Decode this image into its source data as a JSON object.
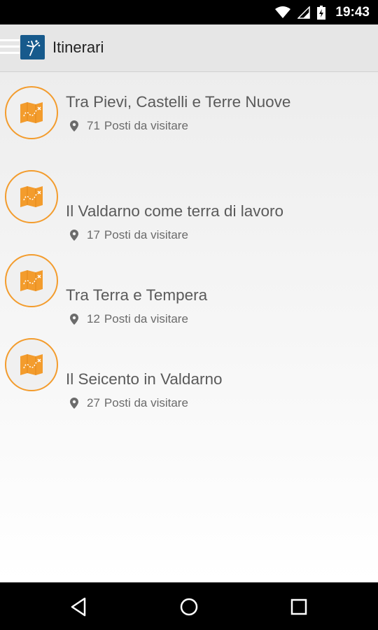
{
  "status_bar": {
    "time": "19:43"
  },
  "app_bar": {
    "title": "Itinerari"
  },
  "itineraries": [
    {
      "title": "Tra Pievi, Castelli e Terre Nuove",
      "count": "71",
      "count_label": "Posti da visitare"
    },
    {
      "title": "Il Valdarno come terra di lavoro",
      "count": "17",
      "count_label": "Posti da visitare"
    },
    {
      "title": "Tra Terra e Tempera",
      "count": "12",
      "count_label": "Posti da visitare"
    },
    {
      "title": "Il Seicento in Valdarno",
      "count": "27",
      "count_label": "Posti da visitare"
    }
  ],
  "colors": {
    "accent": "#f39c2d",
    "logo_bg": "#175a8c",
    "app_bar_bg": "#e6e6e6"
  }
}
